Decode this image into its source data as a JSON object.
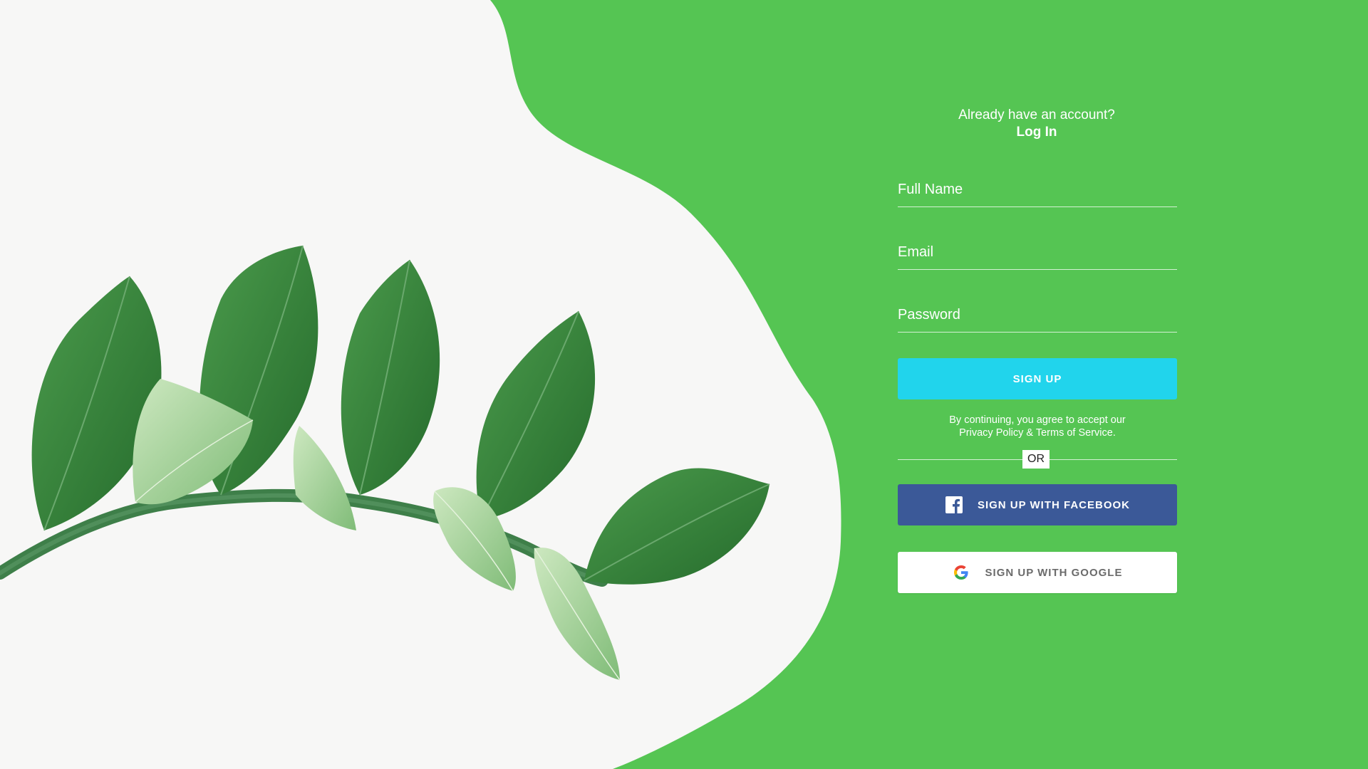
{
  "auth": {
    "login_prompt": "Already have an account?",
    "login_link": "Log In"
  },
  "form": {
    "full_name": {
      "placeholder": "Full Name",
      "value": ""
    },
    "email": {
      "placeholder": "Email",
      "value": ""
    },
    "password": {
      "placeholder": "Password",
      "value": ""
    }
  },
  "actions": {
    "signup_label": "SIGN UP",
    "legal_line1": "By continuing, you agree to accept our",
    "legal_line2": "Privacy Policy & Terms of Service.",
    "divider_label": "OR",
    "facebook_label": "SIGN UP WITH FACEBOOK",
    "google_label": "SIGN UP WITH GOOGLE"
  },
  "icons": {
    "facebook": "facebook-icon",
    "google": "google-icon"
  },
  "colors": {
    "background": "#55c553",
    "signup_button": "#21d4ec",
    "facebook_button": "#3b5998",
    "google_button": "#ffffff",
    "leaf_dark": "#2f7a35",
    "leaf_light": "#9fcf8f"
  }
}
